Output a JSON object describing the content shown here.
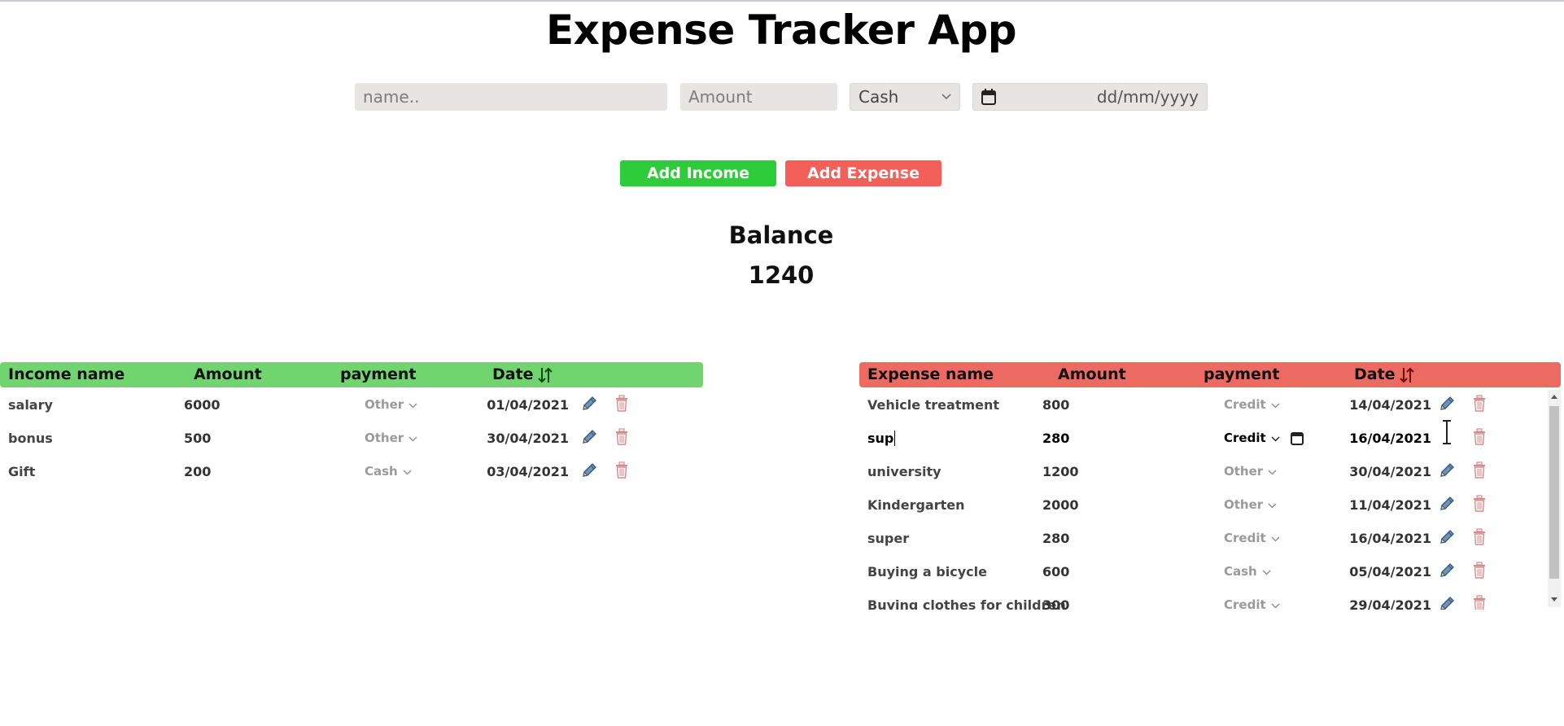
{
  "app": {
    "title": "Expense Tracker App"
  },
  "form": {
    "name_placeholder": "name..",
    "amount_placeholder": "Amount",
    "payment_value": "Cash",
    "date_placeholder": "dd/mm/yyyy"
  },
  "buttons": {
    "add_income": "Add Income",
    "add_expense": "Add Expense"
  },
  "balance": {
    "label": "Balance",
    "value": "1240"
  },
  "income_table": {
    "headers": {
      "name": "Income name",
      "amount": "Amount",
      "payment": "payment",
      "date": "Date"
    },
    "rows": [
      {
        "name": "salary",
        "amount": "6000",
        "payment": "Other",
        "date": "01/04/2021"
      },
      {
        "name": "bonus",
        "amount": "500",
        "payment": "Other",
        "date": "30/04/2021"
      },
      {
        "name": "Gift",
        "amount": "200",
        "payment": "Cash",
        "date": "03/04/2021"
      }
    ]
  },
  "expense_table": {
    "headers": {
      "name": "Expense name",
      "amount": "Amount",
      "payment": "payment",
      "date": "Date"
    },
    "rows": [
      {
        "name": "Vehicle treatment",
        "amount": "800",
        "payment": "Credit",
        "date": "14/04/2021"
      },
      {
        "name": "sup",
        "amount": "280",
        "payment": "Credit",
        "date": "16/04/2021"
      },
      {
        "name": "university",
        "amount": "1200",
        "payment": "Other",
        "date": "30/04/2021"
      },
      {
        "name": "Kindergarten",
        "amount": "2000",
        "payment": "Other",
        "date": "11/04/2021"
      },
      {
        "name": "super",
        "amount": "280",
        "payment": "Credit",
        "date": "16/04/2021"
      },
      {
        "name": "Buying a bicycle",
        "amount": "600",
        "payment": "Cash",
        "date": "05/04/2021"
      },
      {
        "name": "Buying clothes for children",
        "amount": "300",
        "payment": "Credit",
        "date": "29/04/2021"
      }
    ]
  },
  "icons": {
    "edit": "pencil-icon",
    "delete": "trash-icon",
    "sort": "sort-arrows-icon",
    "calendar": "calendar-icon",
    "dropdown": "chevron-down-icon"
  },
  "colors": {
    "income": "#70d46f",
    "expense": "#ec6a62",
    "add_income_btn": "#2ecc3a",
    "add_expense_btn": "#f3605a",
    "field_bg": "#e6e5e4"
  }
}
